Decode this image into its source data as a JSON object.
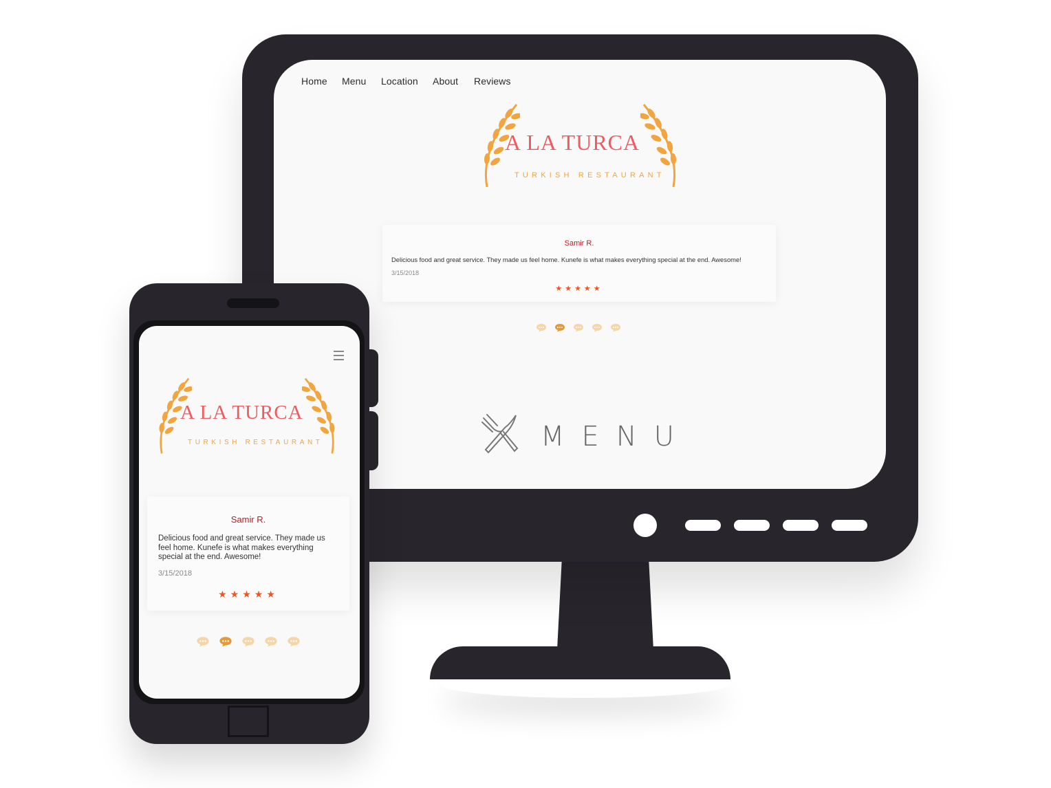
{
  "desktop": {
    "nav": [
      "Home",
      "Menu",
      "Location",
      "About",
      "Reviews"
    ],
    "logo": {
      "title": "A LA TURCA",
      "subtitle": "TURKISH RESTAURANT"
    },
    "review": {
      "name": "Samir R.",
      "text": "Delicious food and great service. They made us feel home. Kunefe is what makes everything special at the end. Awesome!",
      "date": "3/15/2018",
      "stars": "★★★★★",
      "rating": 5
    },
    "carousel": {
      "count": 5,
      "active_index": 1
    },
    "menu_heading": "MENU"
  },
  "mobile": {
    "logo": {
      "title": "A LA TURCA",
      "subtitle": "TURKISH RESTAURANT"
    },
    "review": {
      "name": "Samir R.",
      "text": "Delicious food and great service. They made us feel home. Kunefe is what makes everything special at the end. Awesome!",
      "date": "3/15/2018",
      "stars": "★★★★★",
      "rating": 5
    },
    "carousel": {
      "count": 5,
      "active_index": 1
    }
  },
  "colors": {
    "device": "#28262c",
    "screen": "#f9f9f9",
    "brand_red": "#ee5b60",
    "brand_gold": "#f2a53f",
    "reviewer_red": "#b81d25",
    "star": "#f05421",
    "dot_active": "#e59a3a",
    "dot_inactive": "#f6d5a8"
  },
  "icons": [
    "wheat-laurel-icon",
    "fork-knife-icon",
    "speech-bubble-icon",
    "hamburger-menu-icon",
    "star-icon"
  ]
}
